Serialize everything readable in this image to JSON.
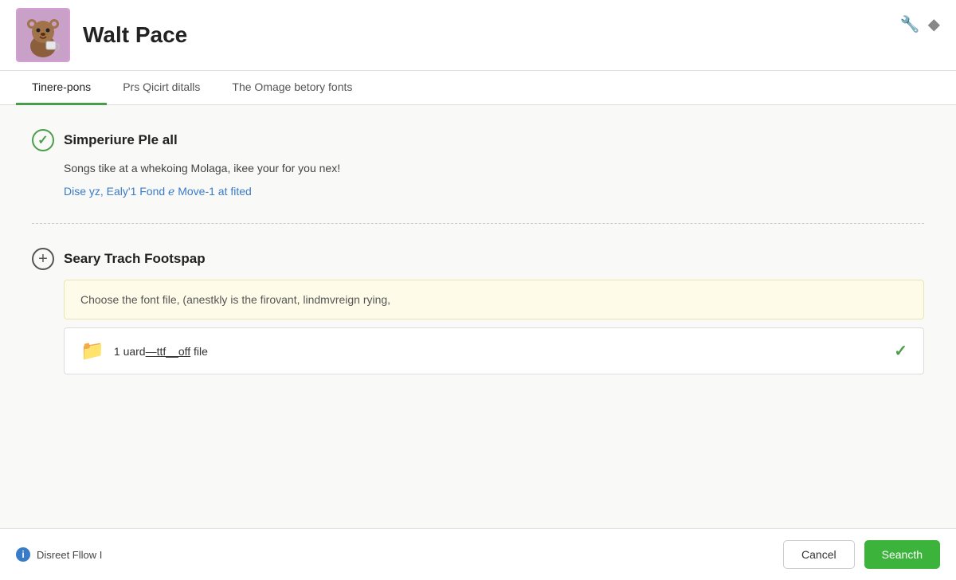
{
  "header": {
    "title": "Walt Pace",
    "icon1": "🔧",
    "icon2": "◆"
  },
  "tabs": [
    {
      "id": "tab1",
      "label": "Tinere-pons",
      "active": true
    },
    {
      "id": "tab2",
      "label": "Prs Qicirt ditalls",
      "active": false
    },
    {
      "id": "tab3",
      "label": "The Omage betory fonts",
      "active": false
    }
  ],
  "sections": [
    {
      "id": "section1",
      "icon_type": "check",
      "title": "Simperiure Ple all",
      "description": "Songs tike at a whekoing Molaga, ikee your for you nex!",
      "link": "Dise yz, Ealy'1 Fond ℯ Move-1 at fited"
    },
    {
      "id": "section2",
      "icon_type": "plus",
      "title": "Seary Trach Footspap",
      "file_input_placeholder": "Choose the font file, (anestkly is the firovant, lindmvreign rying,",
      "file_item": {
        "name": "1 uard—ttf__off file",
        "has_check": true
      }
    }
  ],
  "footer": {
    "info_text": "Disreet Fllow I",
    "cancel_label": "Cancel",
    "submit_label": "Seancth"
  }
}
